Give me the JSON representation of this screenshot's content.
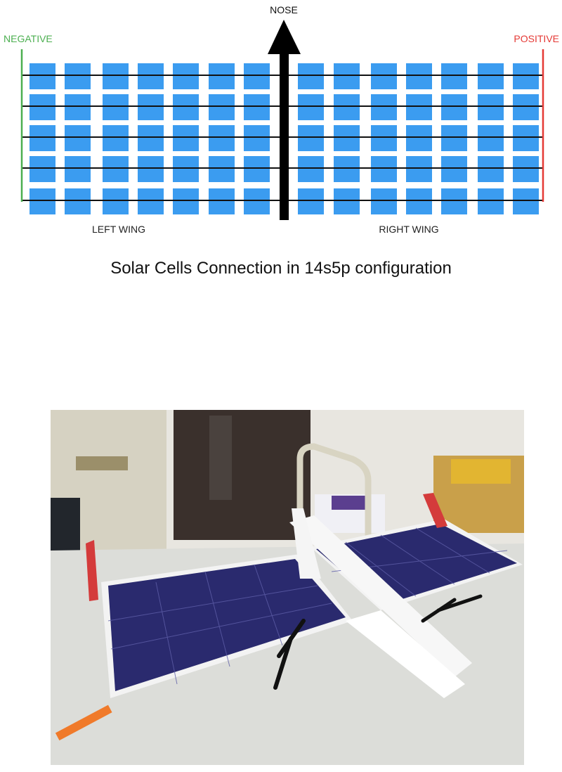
{
  "diagram": {
    "nose_label": "NOSE",
    "negative_label": "NEGATIVE",
    "positive_label": "POSITIVE",
    "left_wing_label": "LEFT WING",
    "right_wing_label": "RIGHT WING",
    "caption": "Solar Cells Connection in 14s5p configuration",
    "rows": 5,
    "cells_per_wing_row": 7,
    "colors": {
      "cell": "#3b9cf0",
      "negative": "#4caf50",
      "positive": "#e53935",
      "wire": "#111111",
      "arrow": "#000000"
    }
  },
  "photo": {
    "subject": "solar-powered-plane-model"
  }
}
